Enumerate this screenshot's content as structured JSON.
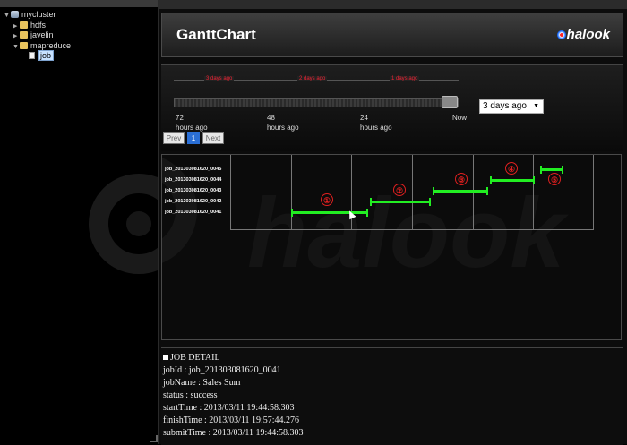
{
  "tree": {
    "root": "mycluster",
    "children": [
      "hdfs",
      "javelin",
      "mapreduce"
    ],
    "selected_child": "job"
  },
  "header": {
    "title": "GanttChart",
    "logo_text": "halook"
  },
  "timeline": {
    "range_labels": [
      "3 days ago",
      "2 days ago",
      "1 days ago"
    ],
    "ticks": [
      {
        "value": "72",
        "unit": "hours ago"
      },
      {
        "value": "48",
        "unit": "hours ago"
      },
      {
        "value": "24",
        "unit": "hours ago"
      },
      {
        "value": "Now",
        "unit": ""
      }
    ],
    "slider_position": 1.0,
    "range_select": "3 days ago",
    "pagination": {
      "prev": "Prev",
      "page": "1",
      "next": "Next"
    }
  },
  "gantt": {
    "jobs": [
      "job_201303081620_0045",
      "job_201303081620_0044",
      "job_201303081620_0043",
      "job_201303081620_0042",
      "job_201303081620_0041"
    ],
    "markers": [
      "①",
      "②",
      "③",
      "④",
      "⑤"
    ],
    "colors": {
      "bar": "#22ee22",
      "marker": "#e02020"
    }
  },
  "detail": {
    "heading": "JOB DETAIL",
    "job_id": "jobId : job_201303081620_0041",
    "job_name": "jobName : Sales Sum",
    "status": "status : success",
    "start_time": "startTime : 2013/03/11 19:44:58.303",
    "finish_time": "finishTime : 2013/03/11 19:57:44.276",
    "submit_time": "submitTime : 2013/03/11 19:44:58.303"
  }
}
